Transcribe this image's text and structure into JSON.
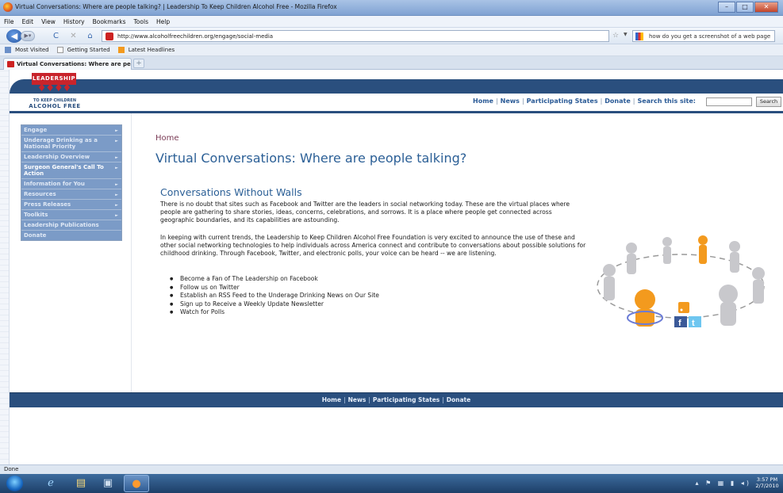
{
  "window": {
    "title": "Virtual Conversations: Where are people talking? | Leadership To Keep Children Alcohol Free - Mozilla Firefox",
    "controls": [
      "–",
      "□",
      "✕"
    ]
  },
  "menu": [
    "File",
    "Edit",
    "View",
    "History",
    "Bookmarks",
    "Tools",
    "Help"
  ],
  "toolbar": {
    "url": "http://www.alcoholfreechildren.org/engage/social-media",
    "search_value": "how do you get a screenshot of a web page"
  },
  "bookmarks": [
    "Most Visited",
    "Getting Started",
    "Latest Headlines"
  ],
  "tabs": [
    {
      "label": "Virtual Conversations: Where are peo..."
    }
  ],
  "newtab_label": "+",
  "logo": {
    "banner": "LEADERSHIP",
    "line1": "TO KEEP CHILDREN",
    "line2": "ALCOHOL FREE"
  },
  "topnav": {
    "items": [
      "Home",
      "News",
      "Participating States",
      "Donate"
    ],
    "search_label": "Search this site:",
    "search_button": "Search"
  },
  "sidebar": {
    "items": [
      {
        "label": "Engage"
      },
      {
        "label": "Underage Drinking as a National Priority"
      },
      {
        "label": "Leadership Overview"
      },
      {
        "label": "Surgeon General's Call To Action"
      },
      {
        "label": "Information for You"
      },
      {
        "label": "Resources"
      },
      {
        "label": "Press Releases"
      },
      {
        "label": "Toolkits"
      },
      {
        "label": "Leadership Publications"
      },
      {
        "label": "Donate"
      }
    ]
  },
  "content": {
    "breadcrumb": "Home",
    "page_title": "Virtual Conversations: Where are people talking?",
    "section_title": "Conversations Without Walls",
    "para1": "There is no doubt that sites such as Facebook and Twitter are the leaders in social networking today.  These are the virtual places where people are gathering to share stories, ideas, concerns, celebrations, and sorrows. It is a place where people get connected across geographic boundaries, and its capabilities are astounding.",
    "para2": "In keeping with current trends, the Leadership to Keep Children Alcohol Free Foundation is very excited to announce the use of these and other social networking technologies to help individuals across America connect and contribute to conversations about possible solutions for childhood drinking.  Through Facebook, Twitter, and electronic polls, your voice can be heard -- we are listening.",
    "bullets": [
      "Become a Fan of The Leadership on Facebook",
      "Follow us on Twitter",
      "Establish an RSS Feed to the Underage Drinking News on Our Site",
      "Sign up to Receive a Weekly Update Newsletter",
      "Watch for Polls"
    ]
  },
  "footer": {
    "items": [
      "Home",
      "News",
      "Participating States",
      "Donate"
    ]
  },
  "status": "Done",
  "clock": {
    "time": "3:57 PM",
    "date": "2/7/2010"
  },
  "colors": {
    "brand_blue": "#2a4f7e",
    "brand_red": "#c8242b",
    "sidebar_bg": "#7b9bc7",
    "heading_blue": "#2b5f96",
    "accent_orange": "#f39a1e"
  }
}
